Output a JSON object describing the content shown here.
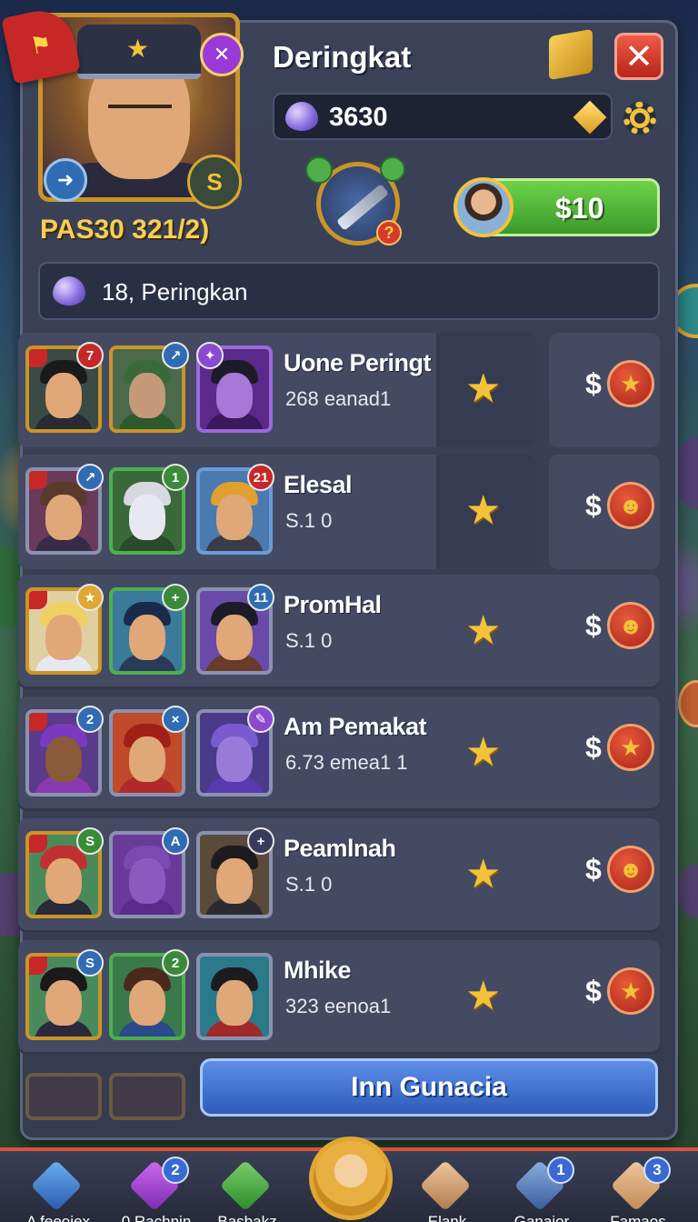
{
  "header": {
    "title": "Deringkat",
    "currency_value": "3630",
    "player_level": "PAS30 321/2)",
    "buy_label": "$10",
    "close_symbol": "✕",
    "question_mark": "?"
  },
  "info_bar": {
    "text": "18, Peringkan"
  },
  "rows": [
    {
      "name": "Uone Peringt",
      "sub": "268 eanad1",
      "badges": [
        "7",
        "↗",
        "✦"
      ]
    },
    {
      "name": "Elesal",
      "sub": "S.1 0",
      "badges": [
        "↗",
        "1",
        "21"
      ]
    },
    {
      "name": "PromHal",
      "sub": "S.1 0",
      "badges": [
        "★",
        "+",
        "11"
      ]
    },
    {
      "name": "Am Pemakat",
      "sub": "6.73 emea1 1",
      "badges": [
        "2",
        "×",
        "✎"
      ]
    },
    {
      "name": "Peamlnah",
      "sub": "S.1 0",
      "badges": [
        "S",
        "A",
        "+"
      ]
    },
    {
      "name": "Mhike",
      "sub": "323 eenoa1",
      "badges": [
        "S",
        "2",
        ""
      ]
    }
  ],
  "row_dollar": "$",
  "big_button": "Inn Gunacia",
  "nav": [
    {
      "label": "A feeoiex",
      "count": ""
    },
    {
      "label": "0 Rachnin",
      "count": "2"
    },
    {
      "label": "Basbakz",
      "count": ""
    },
    {
      "label": "Elank",
      "count": ""
    },
    {
      "label": "Ganaior",
      "count": "1"
    },
    {
      "label": "Famaos",
      "count": "3"
    }
  ],
  "colors": {
    "accent_gold": "#f2c23a",
    "panel": "#3b4258",
    "buy_green": "#4fb83a",
    "close_red": "#d63a2a",
    "big_button_blue": "#3a6ad0"
  },
  "icons": {
    "header": [
      "purple-x-icon",
      "box-icon",
      "close-icon",
      "gem-icon",
      "diamond-icon",
      "gear-icon",
      "weapon-icon"
    ],
    "row": [
      "star-icon",
      "coin-icon"
    ]
  }
}
